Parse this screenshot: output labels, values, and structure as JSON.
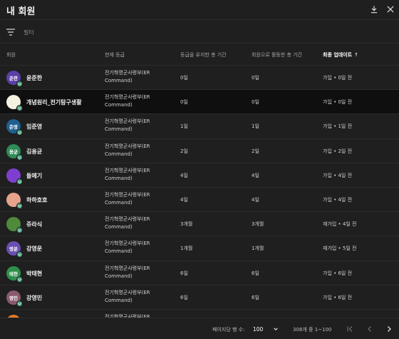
{
  "header": {
    "title": "내 회원"
  },
  "filter": {
    "placeholder": "필터"
  },
  "columns": {
    "member": "회원",
    "level": "현재 등급",
    "time_at_level": "등급을 유지한 총 기간",
    "time_as_member": "회원으로 활동한 총 기간",
    "last_update": "최종 업데이트"
  },
  "rows": [
    {
      "name": "윤준한",
      "avatar_text": "준한",
      "avatar_color": "#5b3fa8",
      "level": "전기혁명군사령부(ER Command)",
      "time_at_level": "0일",
      "time_as_member": "0일",
      "last_update": "가입 • 0일 전"
    },
    {
      "name": "개념원리_전기탐구생활",
      "avatar_text": "",
      "avatar_color": "#f5f1e0",
      "level": "전기혁명군사령부(ER Command)",
      "time_at_level": "0일",
      "time_as_member": "0일",
      "last_update": "가입 • 0일 전"
    },
    {
      "name": "임준영",
      "avatar_text": "준영",
      "avatar_color": "#1e5f8f",
      "level": "전기혁명군사령부(ER Command)",
      "time_at_level": "1일",
      "time_as_member": "1일",
      "last_update": "가입 • 1일 전"
    },
    {
      "name": "김용균",
      "avatar_text": "용균",
      "avatar_color": "#2e8b57",
      "level": "전기혁명군사령부(ER Command)",
      "time_at_level": "2일",
      "time_as_member": "2일",
      "last_update": "가입 • 2일 전"
    },
    {
      "name": "돌메기",
      "avatar_text": "",
      "avatar_color": "#7e3fd0",
      "level": "전기혁명군사령부(ER Command)",
      "time_at_level": "4일",
      "time_as_member": "4일",
      "last_update": "가입 • 4일 전"
    },
    {
      "name": "하하호호",
      "avatar_text": "",
      "avatar_color": "#e8a38c",
      "level": "전기혁명군사령부(ER Command)",
      "time_at_level": "4일",
      "time_as_member": "4일",
      "last_update": "가입 • 4일 전"
    },
    {
      "name": "쥬라식",
      "avatar_text": "",
      "avatar_color": "#4f8a3a",
      "level": "전기혁명군사령부(ER Command)",
      "time_at_level": "3개월",
      "time_as_member": "3개월",
      "last_update": "재가입 • 4일 전"
    },
    {
      "name": "강영운",
      "avatar_text": "영운",
      "avatar_color": "#6a4fb3",
      "level": "전기혁명군사령부(ER Command)",
      "time_at_level": "1개월",
      "time_as_member": "1개월",
      "last_update": "재가입 • 5일 전"
    },
    {
      "name": "박태현",
      "avatar_text": "태현",
      "avatar_color": "#2f8f4a",
      "level": "전기혁명군사령부(ER Command)",
      "time_at_level": "6일",
      "time_as_member": "6일",
      "last_update": "가입 • 6일 전"
    },
    {
      "name": "강영민",
      "avatar_text": "영민",
      "avatar_color": "#8a5a6e",
      "level": "전기혁명군사령부(ER Command)",
      "time_at_level": "6일",
      "time_as_member": "6일",
      "last_update": "가입 • 6일 전"
    },
    {
      "name": "",
      "avatar_text": "",
      "avatar_color": "#e07b2a",
      "level": "전기혁명군사령부(ER Command)",
      "time_at_level": "",
      "time_as_member": "",
      "last_update": ""
    }
  ],
  "footer": {
    "rows_per_page_label": "페이지당 행 수:",
    "rows_per_page_value": "100",
    "range_text": "308개 중 1~100"
  },
  "icons": {
    "download": "download-icon",
    "close": "close-icon",
    "filter": "filter-icon",
    "sort": "arrow-up-icon",
    "first_page": "first-page-icon",
    "prev_page": "chevron-left-icon",
    "next_page": "chevron-right-icon",
    "last_page": "last-page-icon",
    "badge": "membership-badge-icon"
  },
  "colors": {
    "badge": "#3d9b78",
    "background": "#1f1f1f",
    "highlight_row": "#0f0f0f"
  }
}
